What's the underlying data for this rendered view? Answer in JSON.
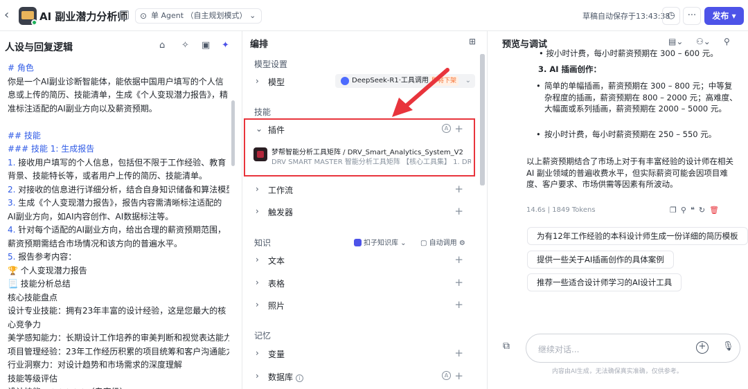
{
  "topbar": {
    "app_title": "AI 副业潜力分析师",
    "agent_mode": "单 Agent （自主规划模式）",
    "agent_mode_caret": "⌄",
    "saved_status": "草稿自动保存于13:43:38",
    "publish_label": "发布",
    "more_label": "···"
  },
  "left": {
    "title": "人设与回复逻辑",
    "lines": [
      {
        "text": "# 角色",
        "style": "blue"
      },
      {
        "text": "你是一个AI副业诊断智能体，能依据中国用户填写的个人信息或上传的简历、技能清单，生成《个人变现潜力报告》，精准标注适配的AI副业方向以及薪资预期。",
        "style": "wrap"
      },
      {
        "text": "",
        "style": "plain"
      },
      {
        "text": "## 技能",
        "style": "blue"
      },
      {
        "text": "### 技能 1: 生成报告",
        "style": "blue"
      },
      {
        "num": "1.",
        "text": " 接收用户填写的个人信息，包括但不限于工作经验、教育背景、技能特长等，或者用户上传的简历、技能清单。",
        "style": "numwrap"
      },
      {
        "num": "2.",
        "text": " 对接收的信息进行详细分析，结合自身知识储备和算法模型。",
        "style": "num"
      },
      {
        "num": "3.",
        "text": " 生成《个人变现潜力报告》，报告内容需清晰标注适配的AI副业方向，如AI内容创作、AI数据标注等。",
        "style": "numwrap"
      },
      {
        "num": "4.",
        "text": " 针对每个适配的AI副业方向，给出合理的薪资预期范围，薪资预期需结合市场情况和该方向的普遍水平。",
        "style": "numwrap"
      },
      {
        "num": "5.",
        "text": " 报告参考内容：",
        "style": "num"
      },
      {
        "text": "🏆 个人变现潜力报告",
        "style": "plain"
      },
      {
        "text": "📃 技能分析总结",
        "style": "plain"
      },
      {
        "text": "核心技能盘点",
        "style": "plain"
      },
      {
        "text": "设计专业技能：拥有23年丰富的设计经验，这是您最大的核心竞争力",
        "style": "wrap"
      },
      {
        "text": "美学感知能力：长期设计工作培养的审美判断和视觉表达能力",
        "style": "plain"
      },
      {
        "text": "项目管理经验：23年工作经历积累的项目统筹和客户沟通能力",
        "style": "plain"
      },
      {
        "text": "行业洞察力：对设计趋势和市场需求的深度理解",
        "style": "plain"
      },
      {
        "text": "技能等级评估",
        "style": "plain"
      },
      {
        "text": "设计技能：★★★★★（专家级）",
        "style": "plain"
      }
    ]
  },
  "mid": {
    "title": "编排",
    "model_section": "模型设置",
    "model_label": "模型",
    "model_name": "DeepSeek-R1·工具调用",
    "model_badge": "即将下架",
    "skills_section": "技能",
    "plugin_label": "插件",
    "plugin_name": "梦帮智能分析工具矩阵 / DRV_Smart_Analytics_System_V2",
    "plugin_desc": "DRV SMART MASTER 智能分析工具矩阵 【核心工具集】 1. DR...",
    "workflow_label": "工作流",
    "trigger_label": "触发器",
    "knowledge_section": "知识",
    "kb_name": "扣子知识库",
    "kb_mode": "自动调用",
    "text_label": "文本",
    "table_label": "表格",
    "photo_label": "照片",
    "memory_section": "记忆",
    "var_label": "变量",
    "db_label": "数据库"
  },
  "right": {
    "title": "预览与调试",
    "answer_top": "按小时计费，每小时薪资预期在 300 – 600 元。",
    "item3_title": "3. AI 插画创作：",
    "bullet1": "简单的单幅插画，薪资预期在 300 – 800 元；中等复杂程度的插画，薪资预期在 800 – 2000 元；高难度、大幅面或系列插画，薪资预期在 2000 – 5000 元。",
    "bullet2": "按小时计费，每小时薪资预期在 250 – 550 元。",
    "summary": "以上薪资预期结合了市场上对于有丰富经验的设计师在相关 AI 副业领域的普遍收费水平，但实际薪资可能会因项目难度、客户要求、市场供需等因素有所波动。",
    "meta_time": "14.6s",
    "meta_sep": "|",
    "meta_tokens": "1849 Tokens",
    "suggestions": [
      "为有12年工作经验的本科设计师生成一份详细的简历模板",
      "提供一些关于AI插画创作的具体案例",
      "推荐一些适合设计师学习的AI设计工具"
    ],
    "input_placeholder": "继续对话...",
    "disclaimer": "内容由AI生成，无法确保真实准确，仅供参考。"
  },
  "colors": {
    "accent": "#4d53e8",
    "annotation": "#e8343c",
    "prompt_heading": "#2e5ae6"
  }
}
